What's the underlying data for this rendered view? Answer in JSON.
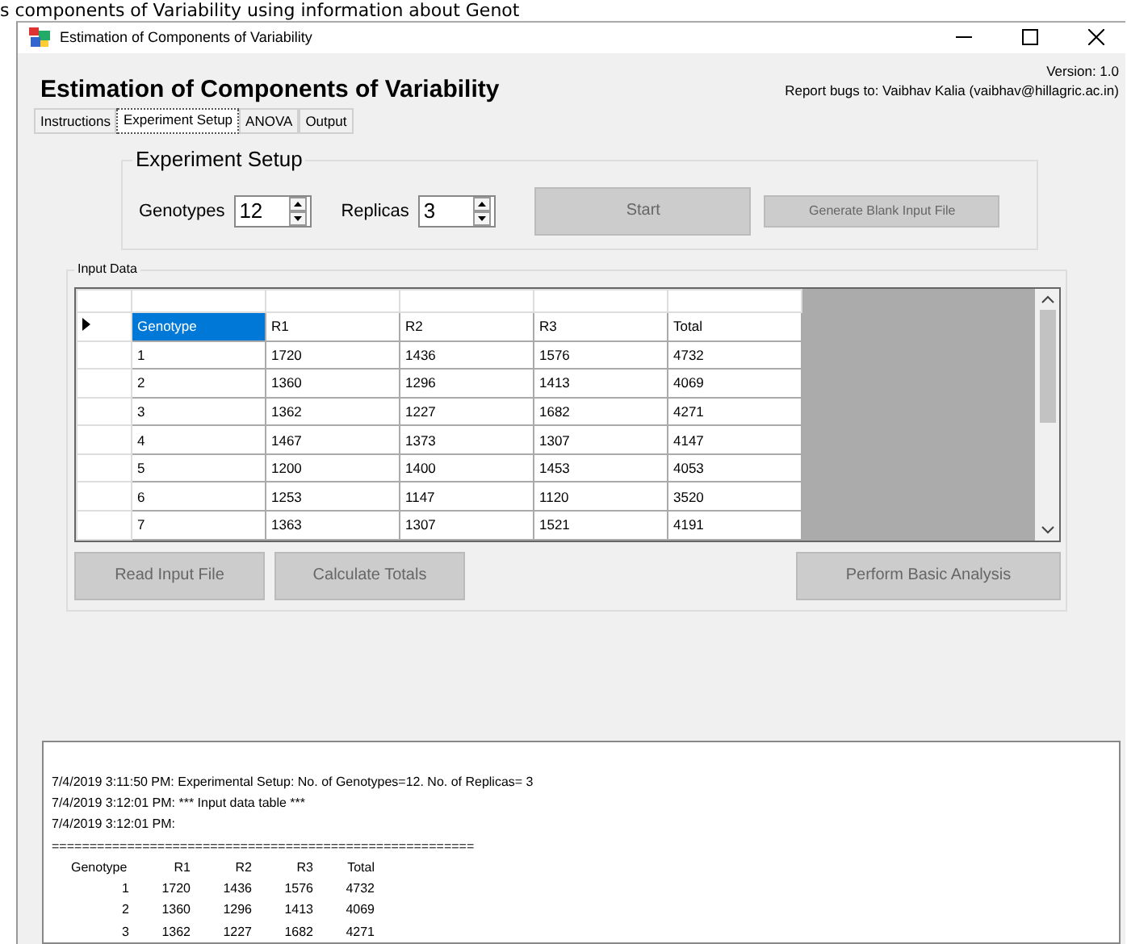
{
  "page_header": "s components of Variability using information about Genot",
  "window": {
    "title": "Estimation of Components of Variability"
  },
  "app": {
    "title": "Estimation of Components of Variability",
    "version": "Version: 1.0",
    "bug_report": "Report bugs to: Vaibhav Kalia (vaibhav@hillagric.ac.in)"
  },
  "tabs": [
    {
      "label": "Instructions",
      "selected": false
    },
    {
      "label": "Experiment Setup",
      "selected": true
    },
    {
      "label": "ANOVA",
      "selected": false
    },
    {
      "label": "Output",
      "selected": false
    }
  ],
  "experiment_setup": {
    "title": "Experiment Setup",
    "genotypes_label": "Genotypes",
    "genotypes_value": "12",
    "replicas_label": "Replicas",
    "replicas_value": "3",
    "start_button": "Start",
    "generate_button": "Generate Blank Input File"
  },
  "input_data": {
    "title": "Input Data",
    "rows": [
      {
        "current": true,
        "cells": [
          {
            "text": "Genotype",
            "selected": true
          },
          {
            "text": "R1",
            "selected": false
          },
          {
            "text": "R2",
            "selected": false
          },
          {
            "text": "R3",
            "selected": false
          },
          {
            "text": "Total",
            "selected": false
          }
        ]
      },
      {
        "current": false,
        "cells": [
          {
            "text": "1",
            "selected": false
          },
          {
            "text": "1720",
            "selected": false
          },
          {
            "text": "1436",
            "selected": false
          },
          {
            "text": "1576",
            "selected": false
          },
          {
            "text": "4732",
            "selected": false
          }
        ]
      },
      {
        "current": false,
        "cells": [
          {
            "text": "2",
            "selected": false
          },
          {
            "text": "1360",
            "selected": false
          },
          {
            "text": "1296",
            "selected": false
          },
          {
            "text": "1413",
            "selected": false
          },
          {
            "text": "4069",
            "selected": false
          }
        ]
      },
      {
        "current": false,
        "cells": [
          {
            "text": "3",
            "selected": false
          },
          {
            "text": "1362",
            "selected": false
          },
          {
            "text": "1227",
            "selected": false
          },
          {
            "text": "1682",
            "selected": false
          },
          {
            "text": "4271",
            "selected": false
          }
        ]
      },
      {
        "current": false,
        "cells": [
          {
            "text": "4",
            "selected": false
          },
          {
            "text": "1467",
            "selected": false
          },
          {
            "text": "1373",
            "selected": false
          },
          {
            "text": "1307",
            "selected": false
          },
          {
            "text": "4147",
            "selected": false
          }
        ]
      },
      {
        "current": false,
        "cells": [
          {
            "text": "5",
            "selected": false
          },
          {
            "text": "1200",
            "selected": false
          },
          {
            "text": "1400",
            "selected": false
          },
          {
            "text": "1453",
            "selected": false
          },
          {
            "text": "4053",
            "selected": false
          }
        ]
      },
      {
        "current": false,
        "cells": [
          {
            "text": "6",
            "selected": false
          },
          {
            "text": "1253",
            "selected": false
          },
          {
            "text": "1147",
            "selected": false
          },
          {
            "text": "1120",
            "selected": false
          },
          {
            "text": "3520",
            "selected": false
          }
        ]
      },
      {
        "current": false,
        "cells": [
          {
            "text": "7",
            "selected": false
          },
          {
            "text": "1363",
            "selected": false
          },
          {
            "text": "1307",
            "selected": false
          },
          {
            "text": "1521",
            "selected": false
          },
          {
            "text": "4191",
            "selected": false
          }
        ]
      }
    ],
    "buttons": [
      "Read Input File",
      "Calculate Totals",
      "Perform Basic Analysis"
    ]
  },
  "log": {
    "lines": [
      "7/4/2019 3:11:50 PM: Experimental Setup: No. of Genotypes=12. No. of Replicas= 3",
      "7/4/2019 3:12:01 PM: *** Input data table ***",
      "7/4/2019 3:12:01 PM:",
      "========================================================"
    ],
    "table": [
      [
        "Genotype",
        "R1",
        "R2",
        "R3",
        "Total"
      ],
      [
        "1",
        "1720",
        "1436",
        "1576",
        "4732"
      ],
      [
        "2",
        "1360",
        "1296",
        "1413",
        "4069"
      ],
      [
        "3",
        "1362",
        "1227",
        "1682",
        "4271"
      ]
    ]
  }
}
